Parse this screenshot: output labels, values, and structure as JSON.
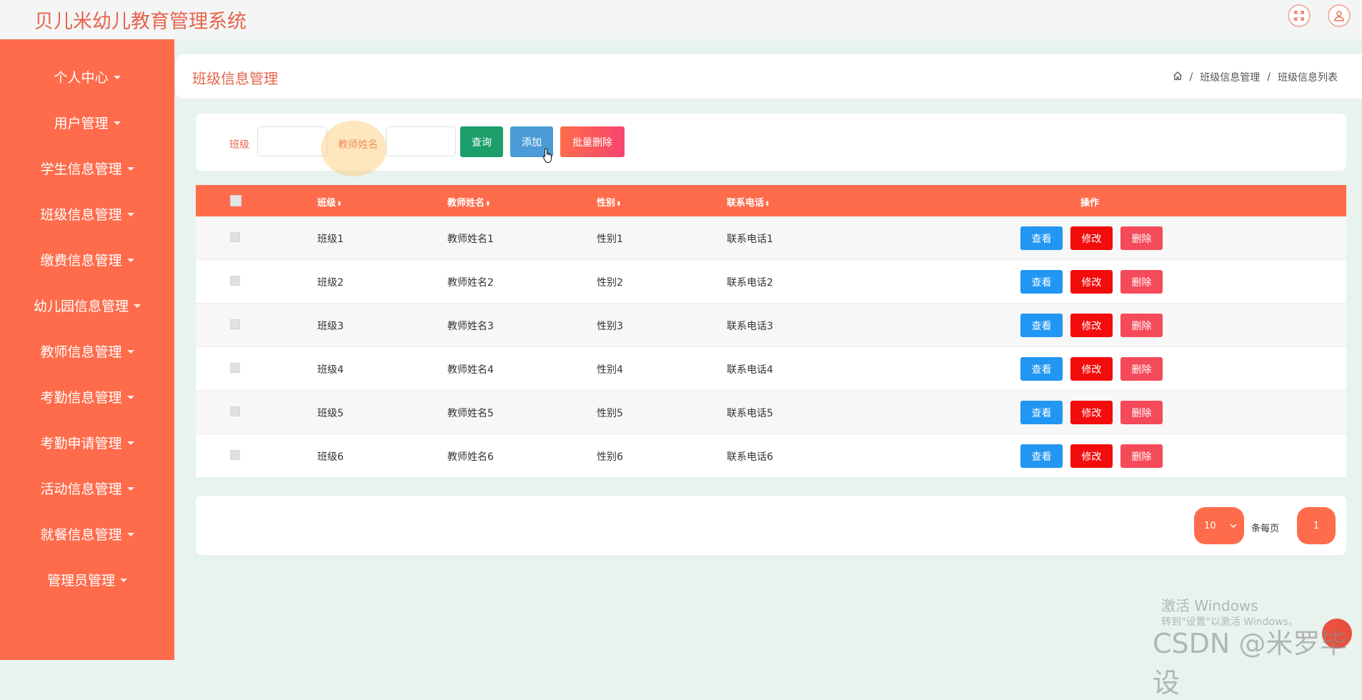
{
  "header": {
    "title": "贝儿米幼儿教育管理系统"
  },
  "sidebar": {
    "items": [
      {
        "label": "个人中心"
      },
      {
        "label": "用户管理"
      },
      {
        "label": "学生信息管理"
      },
      {
        "label": "班级信息管理"
      },
      {
        "label": "缴费信息管理"
      },
      {
        "label": "幼儿园信息管理"
      },
      {
        "label": "教师信息管理"
      },
      {
        "label": "考勤信息管理"
      },
      {
        "label": "考勤申请管理"
      },
      {
        "label": "活动信息管理"
      },
      {
        "label": "就餐信息管理"
      },
      {
        "label": "管理员管理"
      }
    ]
  },
  "page": {
    "title": "班级信息管理",
    "breadcrumb": [
      "班级信息管理",
      "班级信息列表"
    ],
    "breadcrumb_sep": "/"
  },
  "search": {
    "class_label": "班级",
    "class_value": "",
    "teacher_label": "教师姓名",
    "teacher_value": "",
    "query_btn": "查询",
    "add_btn": "添加",
    "batch_delete_btn": "批量删除"
  },
  "table": {
    "columns": [
      "班级",
      "教师姓名",
      "性别",
      "联系电话",
      "操作"
    ],
    "rows": [
      {
        "class": "班级1",
        "teacher": "教师姓名1",
        "gender": "性别1",
        "phone": "联系电话1"
      },
      {
        "class": "班级2",
        "teacher": "教师姓名2",
        "gender": "性别2",
        "phone": "联系电话2"
      },
      {
        "class": "班级3",
        "teacher": "教师姓名3",
        "gender": "性别3",
        "phone": "联系电话3"
      },
      {
        "class": "班级4",
        "teacher": "教师姓名4",
        "gender": "性别4",
        "phone": "联系电话4"
      },
      {
        "class": "班级5",
        "teacher": "教师姓名5",
        "gender": "性别5",
        "phone": "联系电话5"
      },
      {
        "class": "班级6",
        "teacher": "教师姓名6",
        "gender": "性别6",
        "phone": "联系电话6"
      }
    ],
    "actions": {
      "view": "查看",
      "edit": "修改",
      "delete": "删除"
    }
  },
  "pagination": {
    "page_size": "10",
    "per_page_label": "条每页",
    "current_page": "1"
  },
  "watermark": {
    "activate_title": "激活 Windows",
    "activate_sub": "转到\"设置\"以激活 Windows。",
    "csdn": "CSDN @米罗毕设"
  },
  "colors": {
    "primary": "#fe6c4c",
    "view_btn": "#2196f3",
    "edit_btn": "#f20c0c",
    "delete_btn": "#f54a5a",
    "query_btn": "#1b9e6a",
    "add_btn": "#4a9bd6",
    "background": "#e8f3ee"
  },
  "icons": [
    "fullscreen-icon",
    "user-icon",
    "home-icon",
    "caret-down-icon",
    "sort-icon",
    "hand-cursor-icon"
  ]
}
